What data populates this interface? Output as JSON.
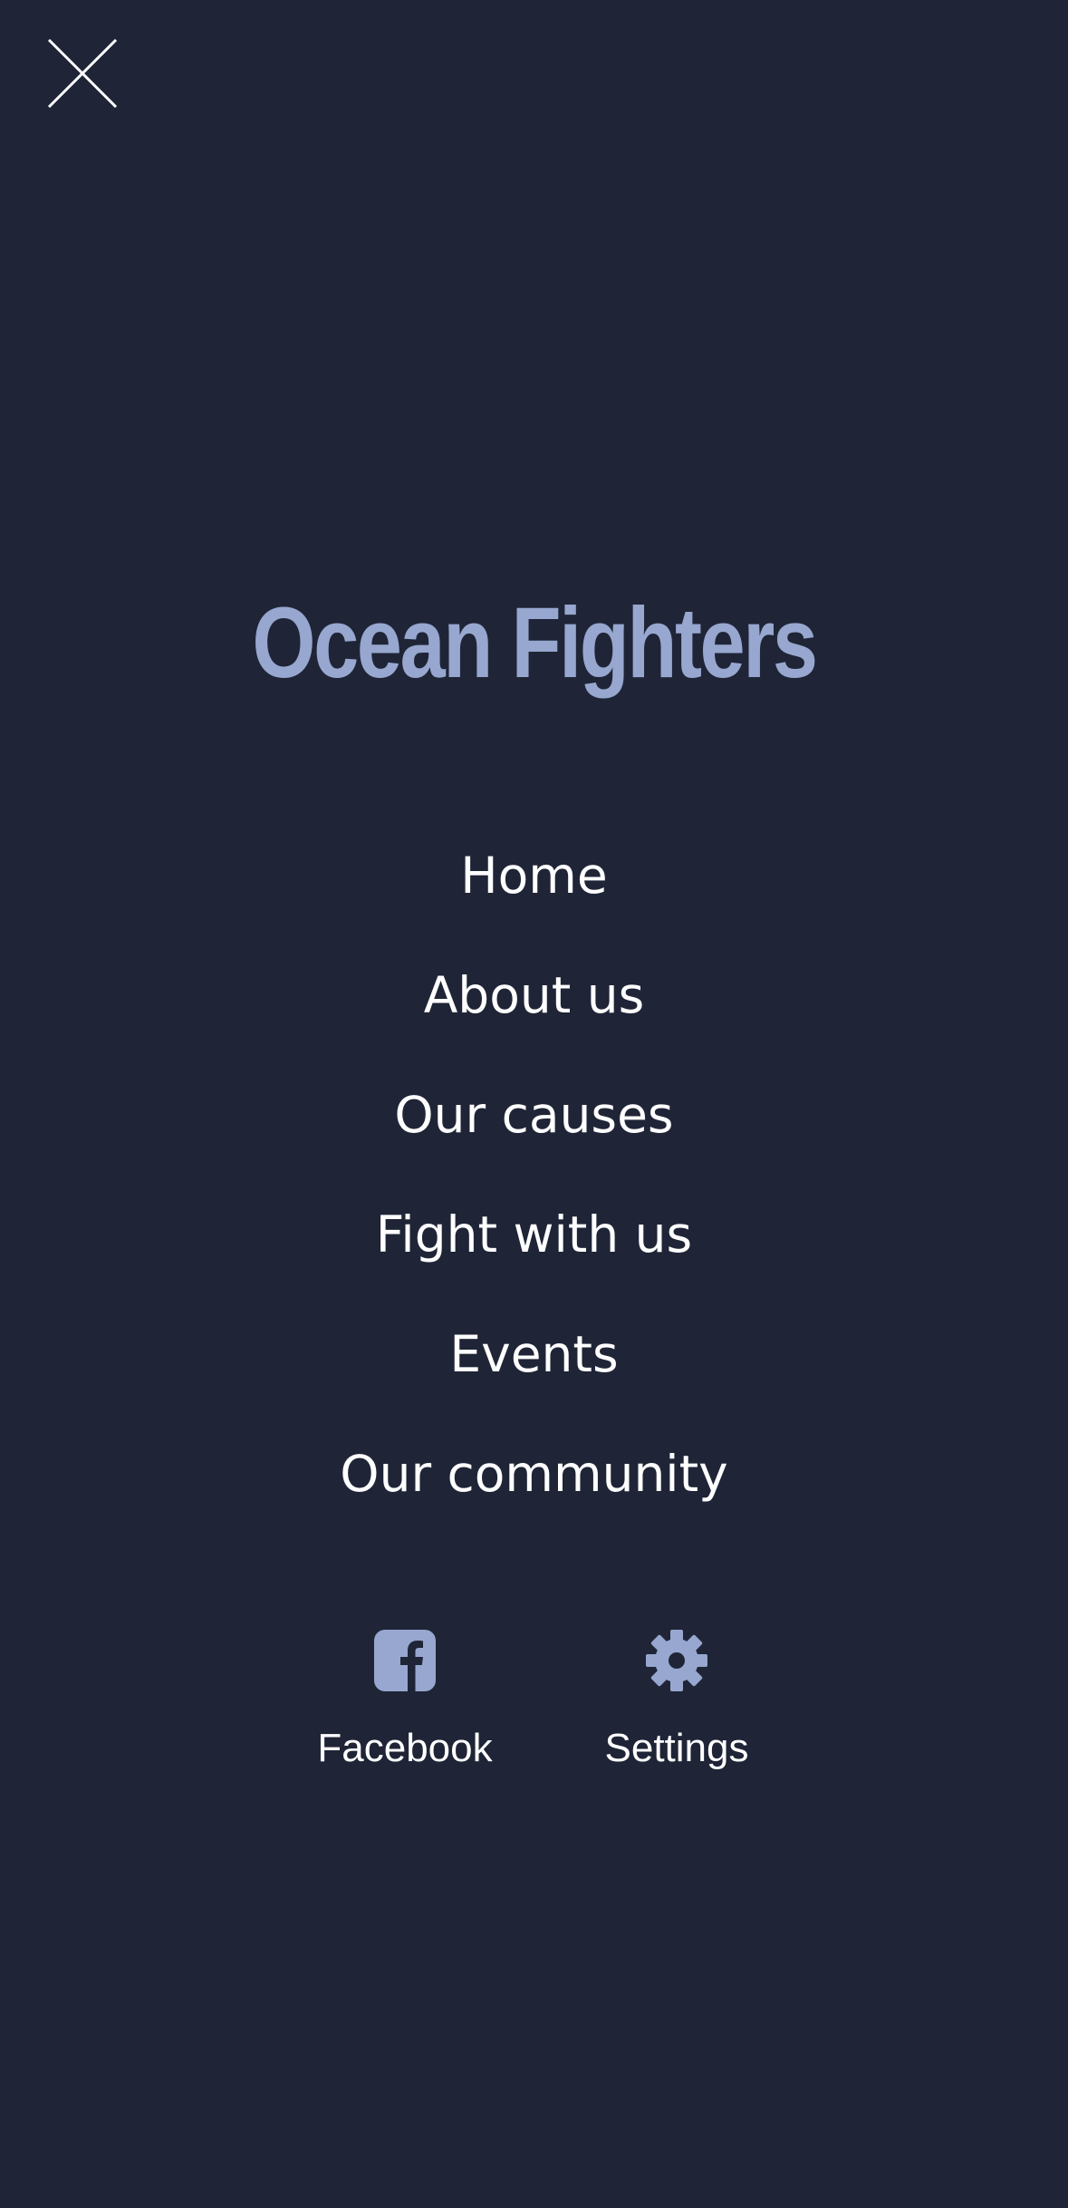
{
  "header": {
    "close_icon": "close-icon"
  },
  "brand": {
    "title": "Ocean Fighters",
    "color": "#97a7cf"
  },
  "nav": {
    "items": [
      {
        "label": "Home"
      },
      {
        "label": "About us"
      },
      {
        "label": "Our causes"
      },
      {
        "label": "Fight with us"
      },
      {
        "label": "Events"
      },
      {
        "label": "Our community"
      }
    ]
  },
  "social": {
    "facebook": {
      "label": "Facebook",
      "icon": "facebook-icon"
    },
    "settings": {
      "label": "Settings",
      "icon": "gear-icon"
    }
  },
  "theme": {
    "background": "#1f2537",
    "text": "#ffffff",
    "accent": "#97a7cf"
  }
}
